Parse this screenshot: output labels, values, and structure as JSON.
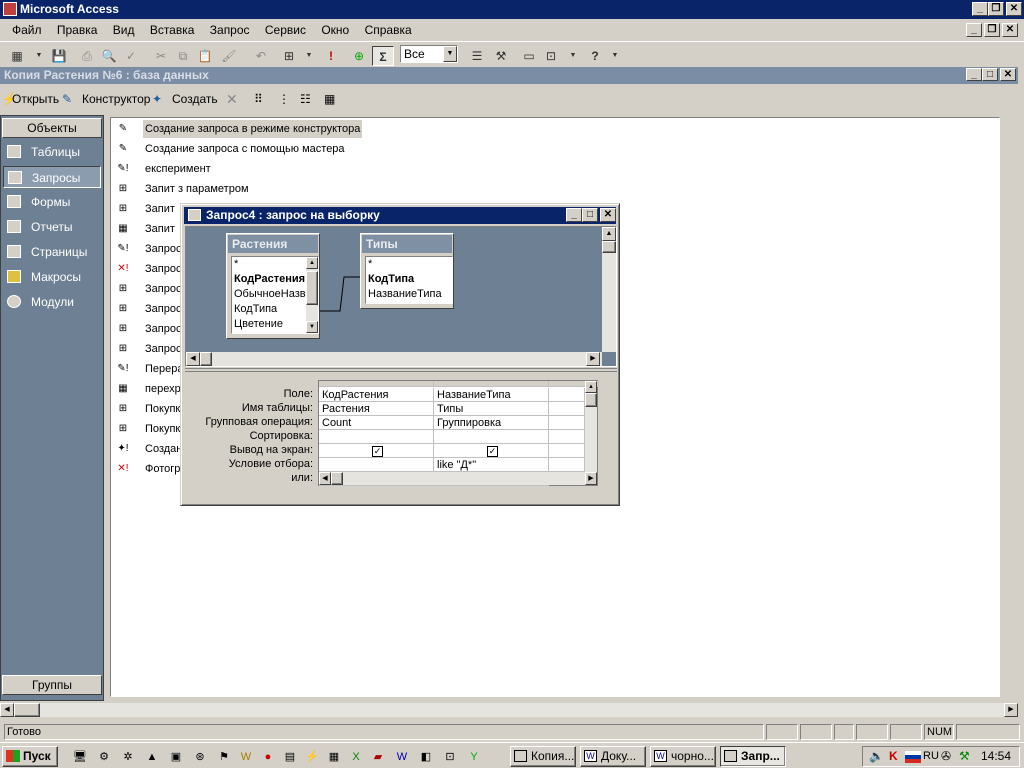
{
  "app": {
    "title": "Microsoft Access"
  },
  "menu": [
    "Файл",
    "Правка",
    "Вид",
    "Вставка",
    "Запрос",
    "Сервис",
    "Окно",
    "Справка"
  ],
  "toolbar": {
    "combo_value": "Все"
  },
  "db_window": {
    "title": "Копия Растения №6 : база данных",
    "actions": {
      "open": "Открыть",
      "design": "Конструктор",
      "create": "Создать"
    },
    "objects_header": "Объекты",
    "groups_label": "Группы",
    "objects": [
      {
        "label": "Таблицы",
        "icon": "table-icon"
      },
      {
        "label": "Запросы",
        "icon": "query-icon"
      },
      {
        "label": "Формы",
        "icon": "form-icon"
      },
      {
        "label": "Отчеты",
        "icon": "report-icon"
      },
      {
        "label": "Страницы",
        "icon": "page-icon"
      },
      {
        "label": "Макросы",
        "icon": "macro-icon"
      },
      {
        "label": "Модули",
        "icon": "module-icon"
      }
    ],
    "items": [
      {
        "label": "Создание запроса в режиме конструктора",
        "icon": "design-wizard-icon"
      },
      {
        "label": "Создание запроса с помощью мастера",
        "icon": "wizard-icon"
      },
      {
        "label": "експеримент",
        "icon": "update-query-icon"
      },
      {
        "label": "Запит з параметром",
        "icon": "select-query-icon"
      },
      {
        "label": "Запит",
        "icon": "select-query-icon"
      },
      {
        "label": "Запит",
        "icon": "table-query-icon"
      },
      {
        "label": "Запрос",
        "icon": "update-query-icon"
      },
      {
        "label": "Запрос",
        "icon": "delete-query-icon"
      },
      {
        "label": "Запрос",
        "icon": "select-query-icon"
      },
      {
        "label": "Запрос",
        "icon": "select-query-icon"
      },
      {
        "label": "Запрос",
        "icon": "select-query-icon"
      },
      {
        "label": "Запрос",
        "icon": "select-query-icon"
      },
      {
        "label": "Перера",
        "icon": "update-query-icon"
      },
      {
        "label": "перехр",
        "icon": "crosstab-query-icon"
      },
      {
        "label": "Покупк",
        "icon": "select-query-icon"
      },
      {
        "label": "Покупк",
        "icon": "select-query-icon"
      },
      {
        "label": "Создан",
        "icon": "make-table-query-icon"
      },
      {
        "label": "Фотогр",
        "icon": "delete-query-icon"
      }
    ]
  },
  "query_window": {
    "title": "Запрос4 : запрос на выборку",
    "tables": [
      {
        "name": "Растения",
        "fields": [
          "*",
          "КодРастения",
          "ОбычноеНазв",
          "КодТипа",
          "Цветение"
        ],
        "pk": "КодРастения"
      },
      {
        "name": "Типы",
        "fields": [
          "*",
          "КодТипа",
          "НазваниеТипа"
        ],
        "pk": "КодТипа"
      }
    ],
    "row_labels": [
      "Поле:",
      "Имя таблицы:",
      "Групповая операция:",
      "Сортировка:",
      "Вывод на экран:",
      "Условие отбора:",
      "или:"
    ],
    "columns": [
      {
        "field": "КодРастения",
        "table": "Растения",
        "group": "Count",
        "sort": "",
        "show": true,
        "criteria": "",
        "or": ""
      },
      {
        "field": "НазваниеТипа",
        "table": "Типы",
        "group": "Группировка",
        "sort": "",
        "show": true,
        "criteria": "like \"Д*\"",
        "or": ""
      }
    ]
  },
  "status": {
    "text": "Готово",
    "num": "NUM"
  },
  "taskbar": {
    "start": "Пуск",
    "tasks": [
      "Копия...",
      "Доку...",
      "чорно...",
      "Запр..."
    ],
    "lang": "RU",
    "clock": "14:54"
  }
}
